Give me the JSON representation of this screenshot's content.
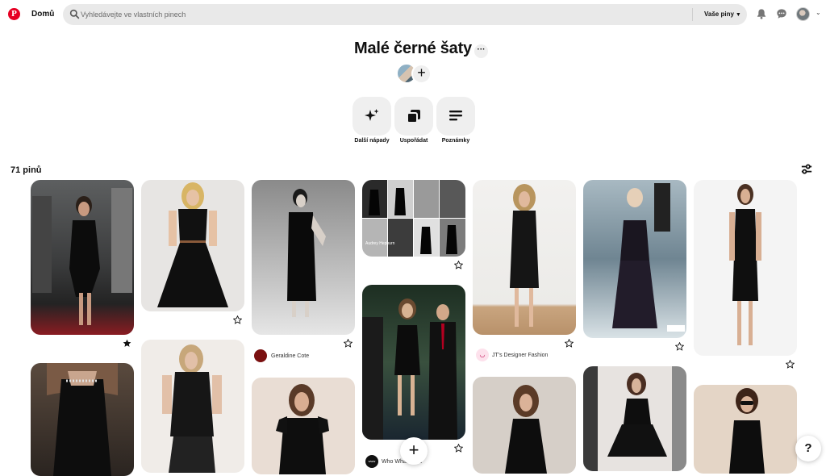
{
  "header": {
    "logo_letter": "P",
    "home_label": "Domů",
    "search_placeholder": "Vyhledávejte ve vlastních pinech",
    "scope_label": "Vaše piny",
    "brand_color": "#e60023"
  },
  "board": {
    "title": "Malé černé šaty",
    "more_label": "···",
    "add_label": "+"
  },
  "actions": [
    {
      "label": "Další nápady",
      "icon": "sparkle-icon"
    },
    {
      "label": "Uspořádat",
      "icon": "organize-icon"
    },
    {
      "label": "Poznámky",
      "icon": "notes-icon"
    }
  ],
  "pins_count": "71 pinů",
  "sources": [
    {
      "name": "Geraldine Cote"
    },
    {
      "name": "JT's Designer Fashion"
    },
    {
      "name": "Who What Wear",
      "badge": "www"
    }
  ],
  "collage_captions": [
    "Audrey Hepburn"
  ],
  "fab_label": "+",
  "help_label": "?"
}
